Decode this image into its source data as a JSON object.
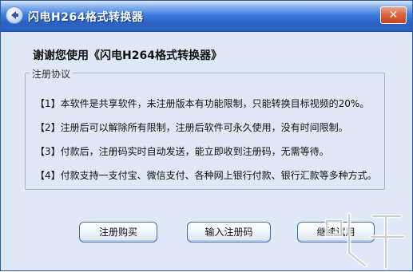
{
  "window": {
    "title": "闪电H264格式转换器",
    "close_glyph": "✕"
  },
  "heading": "谢谢您使用《闪电H264格式转换器》",
  "group": {
    "legend": "注册协议",
    "items": [
      "【1】本软件是共享软件，未注册版本有功能限制，只能转换目标视频的20%。",
      "【2】注册后可以解除所有限制，注册后软件可永久使用，没有时间限制。",
      "【3】付款后，注册码实时自动发送，能立即收到注册码，无需等待。",
      "【4】付款支持一支付宝、微信支付、各种网上银行付款、银行汇款等多种方式。"
    ]
  },
  "buttons": {
    "register_buy": "注册购买",
    "enter_code": "输入注册码",
    "continue_trial": "继续试用"
  },
  "colors": {
    "titlebar": "#2a63c8",
    "window_bg": "#dfe8f6",
    "close_button": "#e06a45"
  }
}
